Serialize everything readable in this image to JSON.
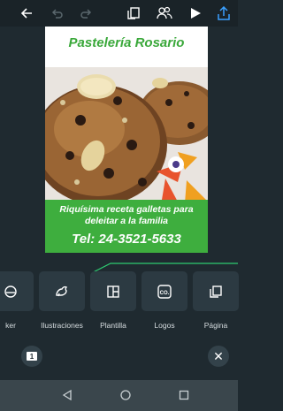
{
  "colors": {
    "accent_green": "#3eae3e",
    "title_green": "#3aa83a",
    "guide_green": "#2ecc71",
    "background": "#1f2a30"
  },
  "topbar": {
    "icons": [
      "back-arrow-icon",
      "undo-icon",
      "redo-icon",
      "copy-icon",
      "add-people-icon",
      "play-icon",
      "share-icon"
    ]
  },
  "design": {
    "title": "Pastelería Rosario",
    "tagline": "Riquísima receta galletas para deleitar a la familia",
    "phone": "Tel: 24-3521-5633"
  },
  "toolbar": {
    "items": [
      {
        "label": "ker",
        "icon": "sticker-icon"
      },
      {
        "label": "Ilustraciones",
        "icon": "illustrations-icon"
      },
      {
        "label": "Plantilla",
        "icon": "template-icon"
      },
      {
        "label": "Logos",
        "icon": "logos-icon"
      },
      {
        "label": "Página",
        "icon": "page-icon"
      }
    ]
  },
  "page_badge": "1",
  "navbar": {
    "icons": [
      "nav-back-icon",
      "nav-home-icon",
      "nav-recents-icon"
    ]
  }
}
